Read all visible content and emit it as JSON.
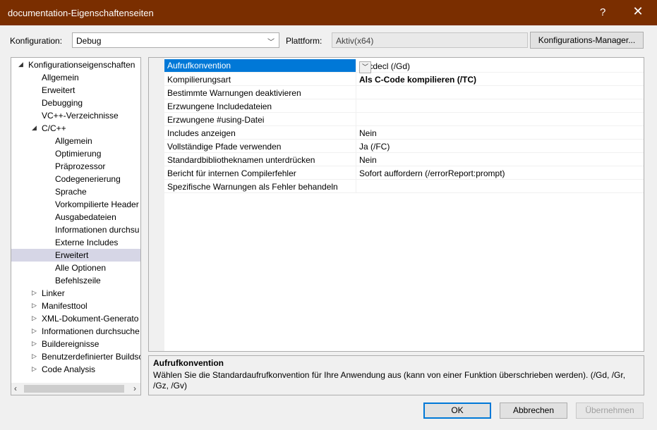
{
  "window": {
    "title": "documentation-Eigenschaftenseiten",
    "help": "?",
    "close": "✕"
  },
  "config": {
    "label": "Konfiguration:",
    "value": "Debug",
    "platform_label": "Plattform:",
    "platform_value": "Aktiv(x64)",
    "manager_button": "Konfigurations-Manager..."
  },
  "tree": {
    "items": [
      {
        "label": "Konfigurationseigenschaften",
        "exp": "◢"
      },
      {
        "label": "Allgemein"
      },
      {
        "label": "Erweitert"
      },
      {
        "label": "Debugging"
      },
      {
        "label": "VC++-Verzeichnisse"
      },
      {
        "label": "C/C++",
        "exp": "◢"
      },
      {
        "label": "Allgemein"
      },
      {
        "label": "Optimierung"
      },
      {
        "label": "Präprozessor"
      },
      {
        "label": "Codegenerierung"
      },
      {
        "label": "Sprache"
      },
      {
        "label": "Vorkompilierte Header"
      },
      {
        "label": "Ausgabedateien"
      },
      {
        "label": "Informationen durchsu"
      },
      {
        "label": "Externe Includes"
      },
      {
        "label": "Erweitert"
      },
      {
        "label": "Alle Optionen"
      },
      {
        "label": "Befehlszeile"
      },
      {
        "label": "Linker",
        "exp": "▷"
      },
      {
        "label": "Manifesttool",
        "exp": "▷"
      },
      {
        "label": "XML-Dokument-Generato",
        "exp": "▷"
      },
      {
        "label": "Informationen durchsuche",
        "exp": "▷"
      },
      {
        "label": "Buildereignisse",
        "exp": "▷"
      },
      {
        "label": "Benutzerdefinierter Buildsc",
        "exp": "▷"
      },
      {
        "label": "Code Analysis",
        "exp": "▷"
      }
    ]
  },
  "properties": [
    {
      "name": "Aufrufkonvention",
      "value": "__cdecl (/Gd)"
    },
    {
      "name": "Kompilierungsart",
      "value": "Als C-Code kompilieren (/TC)"
    },
    {
      "name": "Bestimmte Warnungen deaktivieren",
      "value": ""
    },
    {
      "name": "Erzwungene Includedateien",
      "value": ""
    },
    {
      "name": "Erzwungene #using-Datei",
      "value": ""
    },
    {
      "name": "Includes anzeigen",
      "value": "Nein"
    },
    {
      "name": "Vollständige Pfade verwenden",
      "value": "Ja (/FC)"
    },
    {
      "name": "Standardbibliotheknamen unterdrücken",
      "value": "Nein"
    },
    {
      "name": "Bericht für internen Compilerfehler",
      "value": "Sofort auffordern (/errorReport:prompt)"
    },
    {
      "name": "Spezifische Warnungen als Fehler behandeln",
      "value": ""
    }
  ],
  "description": {
    "title": "Aufrufkonvention",
    "text": "Wählen Sie die Standardaufrufkonvention für Ihre Anwendung aus (kann von einer Funktion überschrieben werden).     (/Gd, /Gr, /Gz, /Gv)"
  },
  "buttons": {
    "ok": "OK",
    "cancel": "Abbrechen",
    "apply": "Übernehmen"
  },
  "icons": {
    "dropdown": "chevron-down-icon",
    "expanded": "expanded-triangle-icon",
    "collapsed": "collapsed-triangle-icon"
  }
}
